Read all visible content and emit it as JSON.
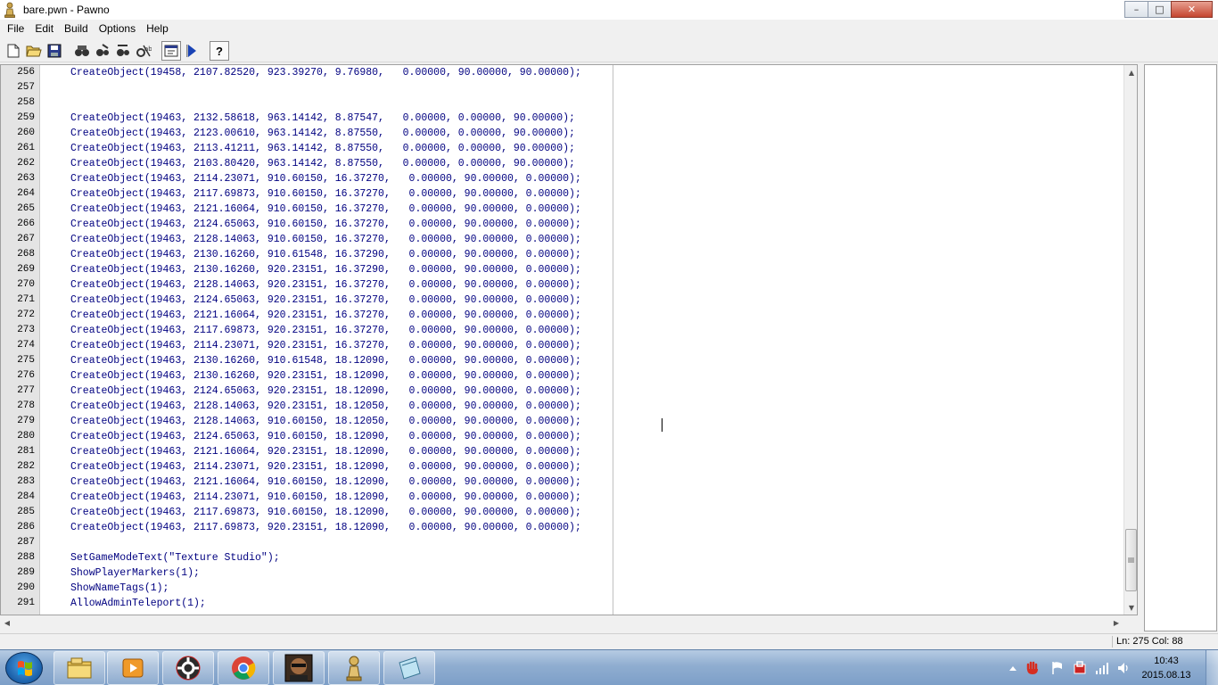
{
  "window": {
    "title": "bare.pwn - Pawno",
    "controls": {
      "minimize": "–",
      "maximize": "□",
      "close": "✕"
    }
  },
  "menu": [
    "File",
    "Edit",
    "Build",
    "Options",
    "Help"
  ],
  "toolbar": {
    "buttons": [
      "new-file-icon",
      "open-folder-icon",
      "save-icon",
      "find-icon",
      "find-next-icon",
      "replace-icon",
      "goto-line-icon",
      "function-list-icon",
      "compile-run-icon",
      "help-icon"
    ]
  },
  "editor": {
    "lines": [
      {
        "n": "256",
        "t": "CreateObject(19458, 2107.82520, 923.39270, 9.76980,   0.00000, 90.00000, 90.00000);"
      },
      {
        "n": "257",
        "t": ""
      },
      {
        "n": "258",
        "t": ""
      },
      {
        "n": "259",
        "t": "CreateObject(19463, 2132.58618, 963.14142, 8.87547,   0.00000, 0.00000, 90.00000);"
      },
      {
        "n": "260",
        "t": "CreateObject(19463, 2123.00610, 963.14142, 8.87550,   0.00000, 0.00000, 90.00000);"
      },
      {
        "n": "261",
        "t": "CreateObject(19463, 2113.41211, 963.14142, 8.87550,   0.00000, 0.00000, 90.00000);"
      },
      {
        "n": "262",
        "t": "CreateObject(19463, 2103.80420, 963.14142, 8.87550,   0.00000, 0.00000, 90.00000);"
      },
      {
        "n": "263",
        "t": "CreateObject(19463, 2114.23071, 910.60150, 16.37270,   0.00000, 90.00000, 0.00000);"
      },
      {
        "n": "264",
        "t": "CreateObject(19463, 2117.69873, 910.60150, 16.37270,   0.00000, 90.00000, 0.00000);"
      },
      {
        "n": "265",
        "t": "CreateObject(19463, 2121.16064, 910.60150, 16.37270,   0.00000, 90.00000, 0.00000);"
      },
      {
        "n": "266",
        "t": "CreateObject(19463, 2124.65063, 910.60150, 16.37270,   0.00000, 90.00000, 0.00000);"
      },
      {
        "n": "267",
        "t": "CreateObject(19463, 2128.14063, 910.60150, 16.37270,   0.00000, 90.00000, 0.00000);"
      },
      {
        "n": "268",
        "t": "CreateObject(19463, 2130.16260, 910.61548, 16.37290,   0.00000, 90.00000, 0.00000);"
      },
      {
        "n": "269",
        "t": "CreateObject(19463, 2130.16260, 920.23151, 16.37290,   0.00000, 90.00000, 0.00000);"
      },
      {
        "n": "270",
        "t": "CreateObject(19463, 2128.14063, 920.23151, 16.37270,   0.00000, 90.00000, 0.00000);"
      },
      {
        "n": "271",
        "t": "CreateObject(19463, 2124.65063, 920.23151, 16.37270,   0.00000, 90.00000, 0.00000);"
      },
      {
        "n": "272",
        "t": "CreateObject(19463, 2121.16064, 920.23151, 16.37270,   0.00000, 90.00000, 0.00000);"
      },
      {
        "n": "273",
        "t": "CreateObject(19463, 2117.69873, 920.23151, 16.37270,   0.00000, 90.00000, 0.00000);"
      },
      {
        "n": "274",
        "t": "CreateObject(19463, 2114.23071, 920.23151, 16.37270,   0.00000, 90.00000, 0.00000);"
      },
      {
        "n": "275",
        "t": "CreateObject(19463, 2130.16260, 910.61548, 18.12090,   0.00000, 90.00000, 0.00000);"
      },
      {
        "n": "276",
        "t": "CreateObject(19463, 2130.16260, 920.23151, 18.12090,   0.00000, 90.00000, 0.00000);"
      },
      {
        "n": "277",
        "t": "CreateObject(19463, 2124.65063, 920.23151, 18.12090,   0.00000, 90.00000, 0.00000);"
      },
      {
        "n": "278",
        "t": "CreateObject(19463, 2128.14063, 920.23151, 18.12050,   0.00000, 90.00000, 0.00000);"
      },
      {
        "n": "279",
        "t": "CreateObject(19463, 2128.14063, 910.60150, 18.12050,   0.00000, 90.00000, 0.00000);"
      },
      {
        "n": "280",
        "t": "CreateObject(19463, 2124.65063, 910.60150, 18.12090,   0.00000, 90.00000, 0.00000);"
      },
      {
        "n": "281",
        "t": "CreateObject(19463, 2121.16064, 920.23151, 18.12090,   0.00000, 90.00000, 0.00000);"
      },
      {
        "n": "282",
        "t": "CreateObject(19463, 2114.23071, 920.23151, 18.12090,   0.00000, 90.00000, 0.00000);"
      },
      {
        "n": "283",
        "t": "CreateObject(19463, 2121.16064, 910.60150, 18.12090,   0.00000, 90.00000, 0.00000);"
      },
      {
        "n": "284",
        "t": "CreateObject(19463, 2114.23071, 910.60150, 18.12090,   0.00000, 90.00000, 0.00000);"
      },
      {
        "n": "285",
        "t": "CreateObject(19463, 2117.69873, 910.60150, 18.12090,   0.00000, 90.00000, 0.00000);"
      },
      {
        "n": "286",
        "t": "CreateObject(19463, 2117.69873, 920.23151, 18.12090,   0.00000, 90.00000, 0.00000);"
      },
      {
        "n": "287",
        "t": ""
      },
      {
        "n": "288",
        "t": "SetGameModeText(\"Texture Studio\");"
      },
      {
        "n": "289",
        "t": "ShowPlayerMarkers(1);"
      },
      {
        "n": "290",
        "t": "ShowNameTags(1);"
      },
      {
        "n": "291",
        "t": "AllowAdminTeleport(1);"
      }
    ]
  },
  "status": {
    "position": "Ln: 275   Col: 88"
  },
  "taskbar": {
    "apps": [
      "windows-explorer-icon",
      "media-player-icon",
      "settings-app-icon",
      "chrome-icon",
      "game-avatar-icon",
      "pawno-icon",
      "notepad-icon"
    ],
    "tray": [
      "show-hidden-icons-icon",
      "hand-app-icon",
      "action-center-flag-icon",
      "security-icon",
      "network-signal-icon",
      "volume-icon"
    ],
    "clock_time": "10:43",
    "clock_date": "2015.08.13"
  },
  "colors": {
    "code_text": "#000080",
    "string_text": "#000080",
    "gutter": "#e4e4e4",
    "taskbar": "#8fadd0"
  }
}
